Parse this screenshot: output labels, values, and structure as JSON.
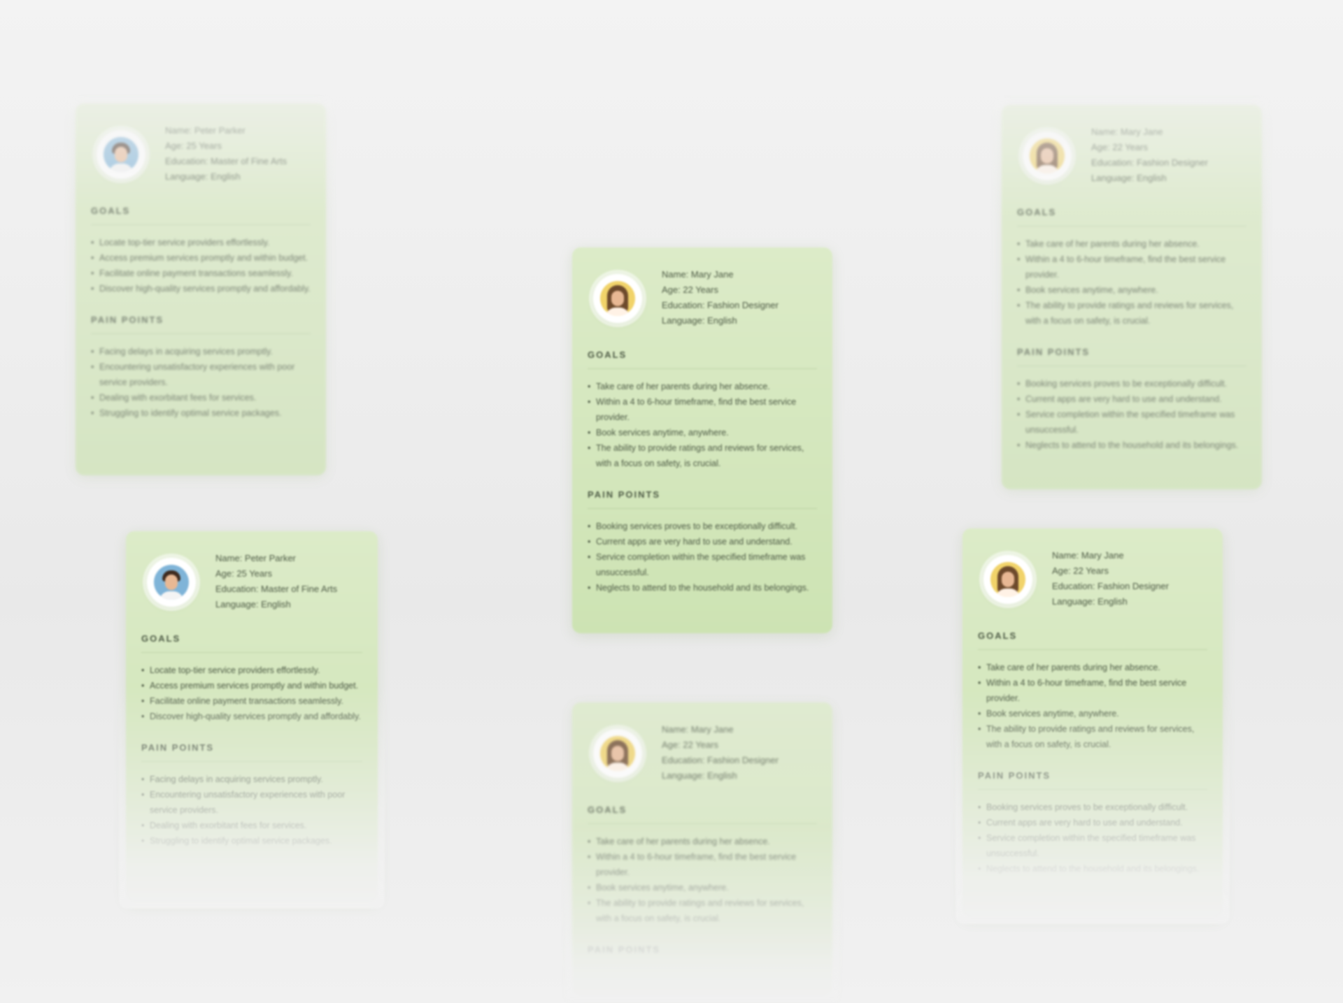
{
  "personas": [
    {
      "id": "a",
      "name": "Name: Peter Parker",
      "age": "Age: 25 Years",
      "education": "Education: Master of Fine Arts",
      "language": "Language: English",
      "goals_title": "GOALS",
      "goals": [
        "Locate top-tier service providers effortlessly.",
        "Access premium services promptly and within budget.",
        "Facilitate online payment transactions seamlessly.",
        "Discover high-quality services promptly and affordably."
      ],
      "pain_title": "PAIN POINTS",
      "pain_points": [
        "Facing delays in acquiring services promptly.",
        "Encountering unsatisfactory experiences with poor service providers.",
        "Dealing with exorbitant fees for services.",
        "Struggling to identify optimal service packages."
      ]
    },
    {
      "id": "b",
      "name": "Name: Peter Parker",
      "age": "Age: 25 Years",
      "education": "Education: Master of Fine Arts",
      "language": "Language: English",
      "goals_title": "GOALS",
      "goals": [
        "Locate top-tier service providers effortlessly.",
        "Access premium services promptly and within budget.",
        "Facilitate online payment transactions seamlessly.",
        "Discover high-quality services promptly and affordably."
      ],
      "pain_title": "PAIN POINTS",
      "pain_points": [
        "Facing delays in acquiring services promptly.",
        "Encountering unsatisfactory experiences with poor service providers.",
        "Dealing with exorbitant fees for services.",
        "Struggling to identify optimal service packages."
      ]
    },
    {
      "id": "c",
      "name": "Name: Mary Jane",
      "age": "Age: 22 Years",
      "education": "Education: Fashion Designer",
      "language": "Language: English",
      "goals_title": "GOALS",
      "goals": [
        "Take care of her parents during her absence.",
        "Within a 4 to 6-hour timeframe, find the best service provider.",
        "Book services anytime, anywhere.",
        "The ability to provide ratings and reviews for services, with a focus on safety, is crucial."
      ],
      "pain_title": "PAIN POINTS",
      "pain_points": [
        "Booking services proves to be exceptionally difficult.",
        "Current apps are very hard to use and understand.",
        "Service completion within the specified timeframe was unsuccessful.",
        "Neglects to attend to the household and its belongings."
      ]
    },
    {
      "id": "d",
      "name": "Name: Mary Jane",
      "age": "Age: 22 Years",
      "education": "Education: Fashion Designer",
      "language": "Language: English",
      "goals_title": "GOALS",
      "goals": [
        "Take care of her parents during her absence.",
        "Within a 4 to 6-hour timeframe, find the best service provider.",
        "Book services anytime, anywhere.",
        "The ability to provide ratings and reviews for services, with a focus on safety, is crucial."
      ],
      "pain_title": "PAIN POINTS",
      "pain_points": []
    },
    {
      "id": "e",
      "name": "Name: Mary Jane",
      "age": "Age: 22 Years",
      "education": "Education: Fashion Designer",
      "language": "Language: English",
      "goals_title": "GOALS",
      "goals": [
        "Take care of her parents during her absence.",
        "Within a 4 to 6-hour timeframe, find the best service provider.",
        "Book services anytime, anywhere.",
        "The ability to provide ratings and reviews for services, with a focus on safety, is crucial."
      ],
      "pain_title": "PAIN POINTS",
      "pain_points": [
        "Booking services proves to be exceptionally difficult.",
        "Current apps are very hard to use and understand.",
        "Service completion within the specified timeframe was unsuccessful.",
        "Neglects to attend to the household and its belongings."
      ]
    },
    {
      "id": "f",
      "name": "Name: Mary Jane",
      "age": "Age: 22 Years",
      "education": "Education: Fashion Designer",
      "language": "Language: English",
      "goals_title": "GOALS",
      "goals": [
        "Take care of her parents during her absence.",
        "Within a 4 to 6-hour timeframe, find the best service provider.",
        "Book services anytime, anywhere.",
        "The ability to provide ratings and reviews for services, with a focus on safety, is crucial."
      ],
      "pain_title": "PAIN POINTS",
      "pain_points": [
        "Booking services proves to be exceptionally difficult.",
        "Current apps are very hard to use and understand.",
        "Service completion within the specified timeframe was unsuccessful.",
        "Neglects to attend to the household and its belongings."
      ]
    }
  ],
  "colors": {
    "card_top": "#dcebc8",
    "card_bottom": "#cde3b3",
    "background": "#efefef",
    "text": "#4d5a45"
  }
}
